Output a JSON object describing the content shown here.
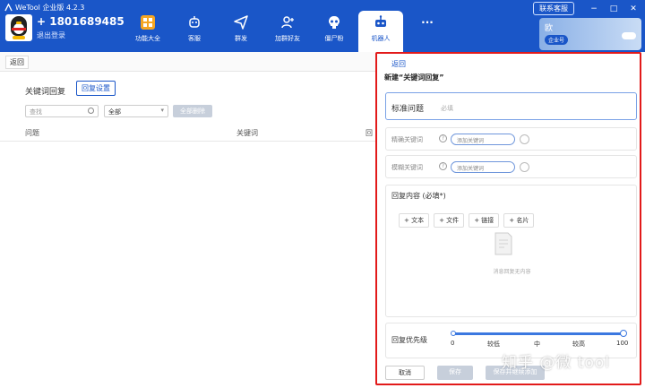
{
  "window": {
    "title": "WeTool 企业版 4.2.3",
    "support_label": "联系客服",
    "minimize": "−",
    "maximize": "□",
    "close": "✕"
  },
  "user": {
    "phone": "+ 1801689485",
    "logout": "退出登录"
  },
  "nav": {
    "items": [
      {
        "label": "功能大全",
        "icon": "grid-icon"
      },
      {
        "label": "客服",
        "icon": "robot-customer-service-icon"
      },
      {
        "label": "群发",
        "icon": "paper-plane-icon"
      },
      {
        "label": "加群好友",
        "icon": "add-friend-icon"
      },
      {
        "label": "僵尸粉",
        "icon": "skull-icon"
      },
      {
        "label": "机器人",
        "icon": "robot-icon",
        "active": true
      },
      {
        "label": "···",
        "icon": "more-icon"
      }
    ]
  },
  "account": {
    "name": "欧",
    "badge": "企业号"
  },
  "tabs": {
    "back": "返回"
  },
  "left": {
    "title": "关键词回复",
    "reply_settings": "回复设置",
    "search_placeholder": "查找",
    "select_value": "全部",
    "delete_all": "全部删除",
    "columns": [
      "问题",
      "关键词",
      "回"
    ]
  },
  "drawer": {
    "back": "返回",
    "title": "新建“关键词回复”",
    "question_label": "标准问题",
    "question_placeholder": "必填",
    "exact_keyword_label": "精确关键词",
    "fuzzy_keyword_label": "模糊关键词",
    "keyword_placeholder": "添加关键词",
    "reply_title": "回复内容 (必填*)",
    "add_buttons": [
      "+ 文本",
      "+ 文件",
      "+ 链接",
      "+ 名片"
    ],
    "empty_text": "消息回复无内容",
    "priority_label": "回复优先级",
    "priority_value": 100,
    "priority_ticks": [
      {
        "label": "0"
      },
      {
        "label": "较低"
      },
      {
        "label": "中"
      },
      {
        "label": "较高"
      },
      {
        "label": "100"
      }
    ],
    "cancel": "取消",
    "save": "保存",
    "save_continue": "保存并继续添加"
  },
  "watermark": "知乎 @微 tool",
  "colors": {
    "brand": "#1a56c8",
    "highlight_border": "#e21a1a",
    "disabled": "#c7cfdb"
  }
}
